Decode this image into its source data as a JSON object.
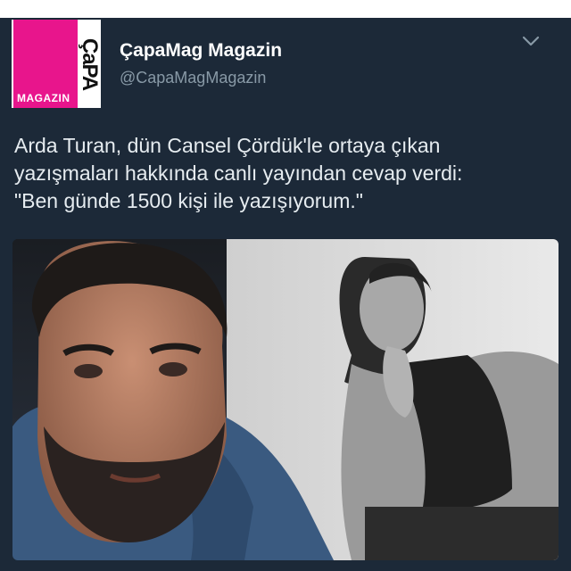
{
  "tweet": {
    "account_name": "ÇapaMag Magazin",
    "handle": "@CapaMagMagazin",
    "logo": {
      "vertical_text": "ÇaPA",
      "badge_text": "MAGAZIN"
    },
    "lines": [
      "Arda Turan, dün Cansel Çördük'le ortaya çıkan",
      "yazışmaları hakkında canlı yayından cevap verdi:",
      "\"Ben günde 1500 kişi ile yazışıyorum.\""
    ],
    "menu_icon": "chevron-down-icon"
  },
  "colors": {
    "background": "#1c2938",
    "name": "#ffffff",
    "handle": "#8899a6",
    "text": "#e6ecf0",
    "logo_pink": "#e8158c"
  }
}
